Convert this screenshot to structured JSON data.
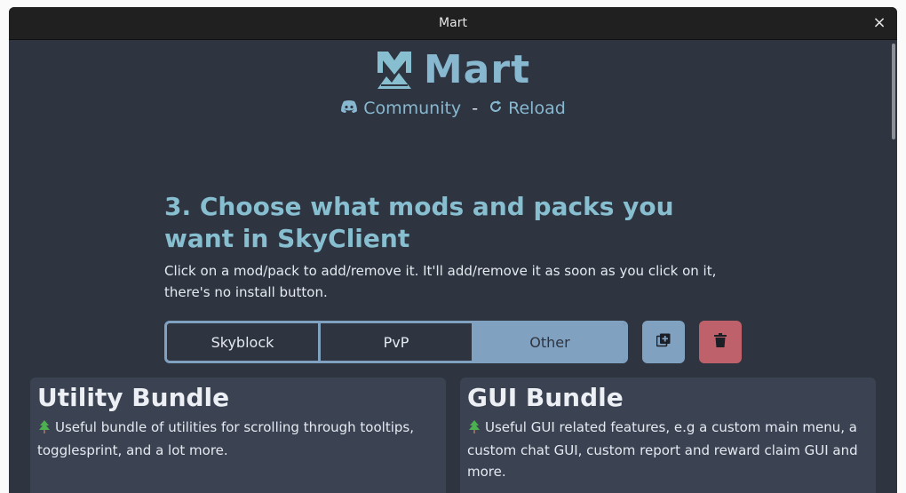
{
  "window": {
    "title": "Mart",
    "close_glyph": "×"
  },
  "brand": {
    "name": "Mart",
    "logo_icon": "mart-logo-icon"
  },
  "links": {
    "community": "Community",
    "separator": "-",
    "reload": "Reload"
  },
  "section": {
    "heading": "3. Choose what mods and packs you want in SkyClient",
    "description": "Click on a mod/pack to add/remove it. It'll add/remove it as soon as you click on it, there's no install button."
  },
  "tabs": [
    {
      "label": "Skyblock",
      "active": false
    },
    {
      "label": "PvP",
      "active": false
    },
    {
      "label": "Other",
      "active": true
    }
  ],
  "buttons": {
    "add_icon": "add-library-icon",
    "delete_icon": "trash-icon"
  },
  "colors": {
    "accent": "#88bfd0",
    "tab_border": "#81a1c1",
    "danger": "#bf616a",
    "background": "#2e3440",
    "card": "#3b4252"
  },
  "cards": [
    {
      "title": "Utility Bundle",
      "description": "Useful bundle of utilities for scrolling through tooltips, togglesprint, and a lot more."
    },
    {
      "title": "GUI Bundle",
      "description": "Useful GUI related features, e.g a custom main menu, a custom chat GUI, custom report and reward claim GUI and more."
    }
  ]
}
